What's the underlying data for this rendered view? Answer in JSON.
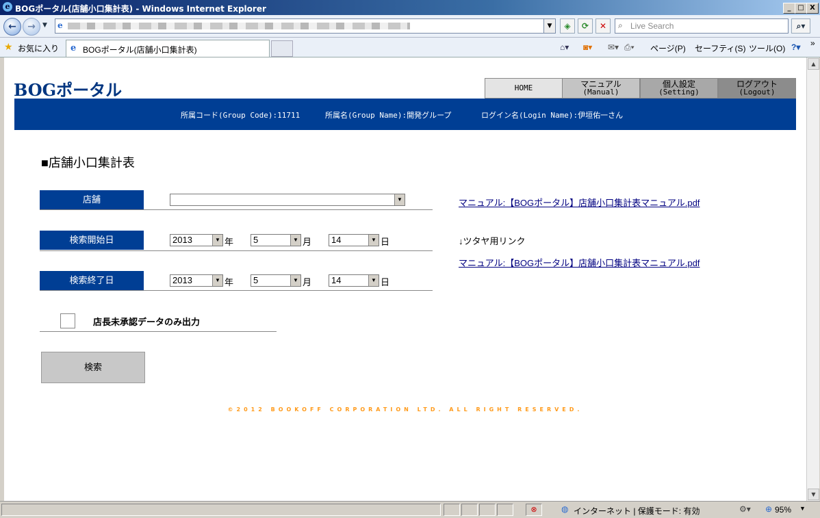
{
  "window": {
    "title": "BOGポータル(店舗小口集計表) - Windows Internet Explorer",
    "controls": [
      "_",
      "□",
      "X"
    ]
  },
  "browser": {
    "address_value": "",
    "search_placeholder": "Live Search",
    "favorites_label": "お気に入り",
    "tab_title": "BOGポータル(店舗小口集計表)",
    "page_menu": "ページ(P)",
    "safety_menu": "セーフティ(S)",
    "tools_menu": "ツール(O)"
  },
  "site": {
    "logo": "BOGポータル",
    "nav": {
      "home": "HOME",
      "manual_ja": "マニュアル",
      "manual_en": "(Manual)",
      "setting_ja": "個人設定",
      "setting_en": "(Setting)",
      "logout_ja": "ログアウト",
      "logout_en": "(Logout)"
    },
    "info": {
      "group_code": "所属コード(Group Code):11711",
      "group_name": "所属名(Group Name):開発グループ",
      "login_name": "ログイン名(Login Name):伊垣佑一さん"
    }
  },
  "form": {
    "heading": "■店舗小口集計表",
    "store_label": "店舗",
    "store_value": "",
    "start_label": "検索開始日",
    "start": {
      "year": "2013",
      "month": "5",
      "day": "14"
    },
    "end_label": "検索終了日",
    "end": {
      "year": "2013",
      "month": "5",
      "day": "14"
    },
    "unit_year": "年",
    "unit_month": "月",
    "unit_day": "日",
    "checkbox_label": "店長未承認データのみ出力",
    "search_button": "検索"
  },
  "links": {
    "manual1": "マニュアル:【BOGポータル】店舗小口集計表マニュアル.pdf",
    "tsutaya_note": "↓ツタヤ用リンク",
    "manual2": "マニュアル:【BOGポータル】店舗小口集計表マニュアル.pdf"
  },
  "footer": {
    "copyright": "©2012 BOOKOFF CORPORATION LTD. ALL RIGHT RESERVED."
  },
  "statusbar": {
    "zone": "インターネット | 保護モード: 有効",
    "zoom": "95%"
  },
  "colors": {
    "brand_blue": "#003e94",
    "copyright_orange": "#ff9a1a",
    "link": "#000080"
  }
}
